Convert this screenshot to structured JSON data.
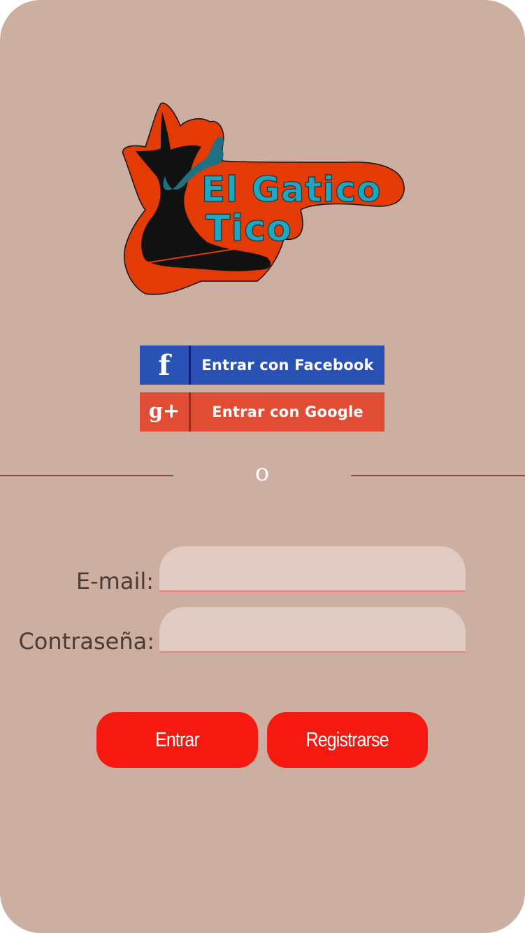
{
  "logo": {
    "line1": "El Gatico",
    "line2": "Tico",
    "colors": {
      "outline": "#e43a05",
      "cat": "#111111",
      "text": "#20a6be",
      "mustache": "#1f7080"
    }
  },
  "social": {
    "facebook": {
      "icon": "f",
      "icon_name": "facebook-icon",
      "label": "Entrar con Facebook",
      "color": "#2a52b4"
    },
    "google": {
      "icon": "g+",
      "icon_name": "google-plus-icon",
      "label": "Entrar con Google",
      "color": "#e04d34"
    }
  },
  "divider": {
    "text": "o"
  },
  "form": {
    "email": {
      "label": "E-mail:",
      "value": "",
      "placeholder": ""
    },
    "password": {
      "label": "Contraseña:",
      "value": "",
      "placeholder": ""
    }
  },
  "actions": {
    "login_label": "Entrar",
    "register_label": "Registrarse",
    "color": "#f51912"
  },
  "theme": {
    "background": "#ccafa1",
    "field": "#dfcbc1",
    "text": "#4d3a35"
  }
}
